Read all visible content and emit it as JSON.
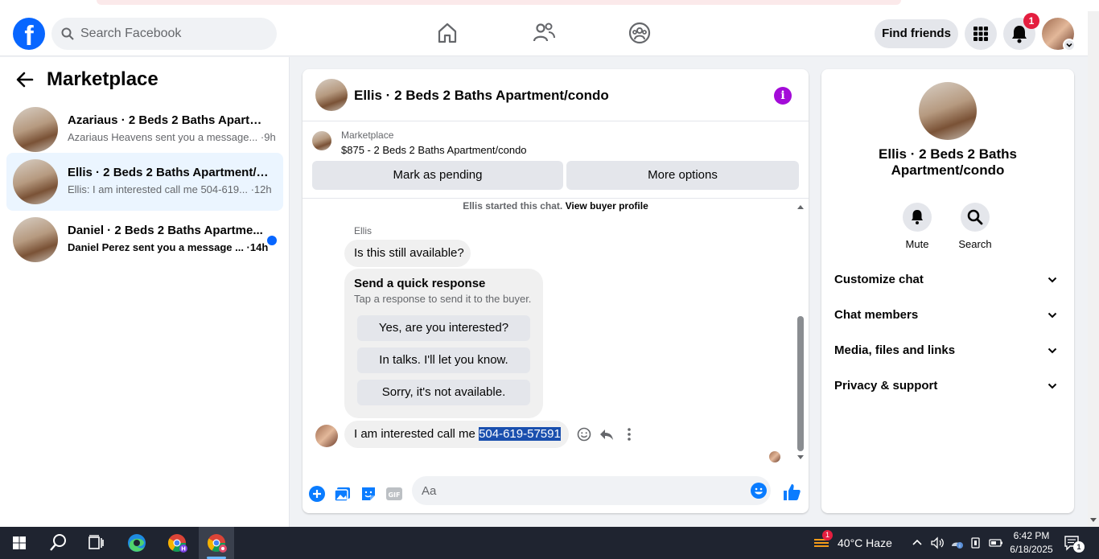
{
  "top_nav": {
    "logo": "f",
    "search_placeholder": "Search Facebook",
    "find_friends_label": "Find friends",
    "notification_count": "1"
  },
  "sidebar": {
    "title": "Marketplace",
    "conversations": [
      {
        "title": "Azariaus · 2 Beds 2 Baths Apartme...",
        "subtitle": "Azariaus Heavens sent you a message... ·9h",
        "active": false,
        "unread": false
      },
      {
        "title": "Ellis · 2 Beds 2 Baths Apartment/c...",
        "subtitle": "Ellis: I am interested call me 504-619... ·12h",
        "active": true,
        "unread": false
      },
      {
        "title": "Daniel · 2 Beds 2 Baths Apartme...",
        "subtitle": "Daniel Perez sent you a message ... ·14h",
        "active": false,
        "unread": true
      }
    ]
  },
  "chat": {
    "title": "Ellis · 2 Beds 2 Baths Apartment/condo",
    "listing_category": "Marketplace",
    "listing_price": "$875 - 2 Beds 2 Baths Apartment/condo",
    "mark_pending_label": "Mark as pending",
    "more_options_label": "More options",
    "started_text": "Ellis started this chat.",
    "view_profile_label": "View buyer profile",
    "sender_name": "Ellis",
    "first_message": "Is this still available?",
    "quick_response_title": "Send a quick response",
    "quick_response_sub": "Tap a response to send it to the buyer.",
    "quick_responses": [
      "Yes, are you interested?",
      "In talks. I'll let you know.",
      "Sorry, it's not available."
    ],
    "last_message_prefix": "I am interested call me ",
    "last_message_selected": "504-619-57591",
    "composer_placeholder": "Aa"
  },
  "right_panel": {
    "title": "Ellis · 2 Beds 2 Baths Apartment/condo",
    "mute_label": "Mute",
    "search_label": "Search",
    "rows": [
      "Customize chat",
      "Chat members",
      "Media, files and links",
      "Privacy & support"
    ]
  },
  "taskbar": {
    "weather_badge": "1",
    "weather": "40°C  Haze",
    "time": "6:42 PM",
    "date": "6/18/2025",
    "notification_count": "1"
  },
  "colors": {
    "facebook_blue": "#0866ff",
    "messenger_blue": "#0a7cff",
    "info_purple": "#a30bd8",
    "selection_blue": "#1a4fae"
  }
}
